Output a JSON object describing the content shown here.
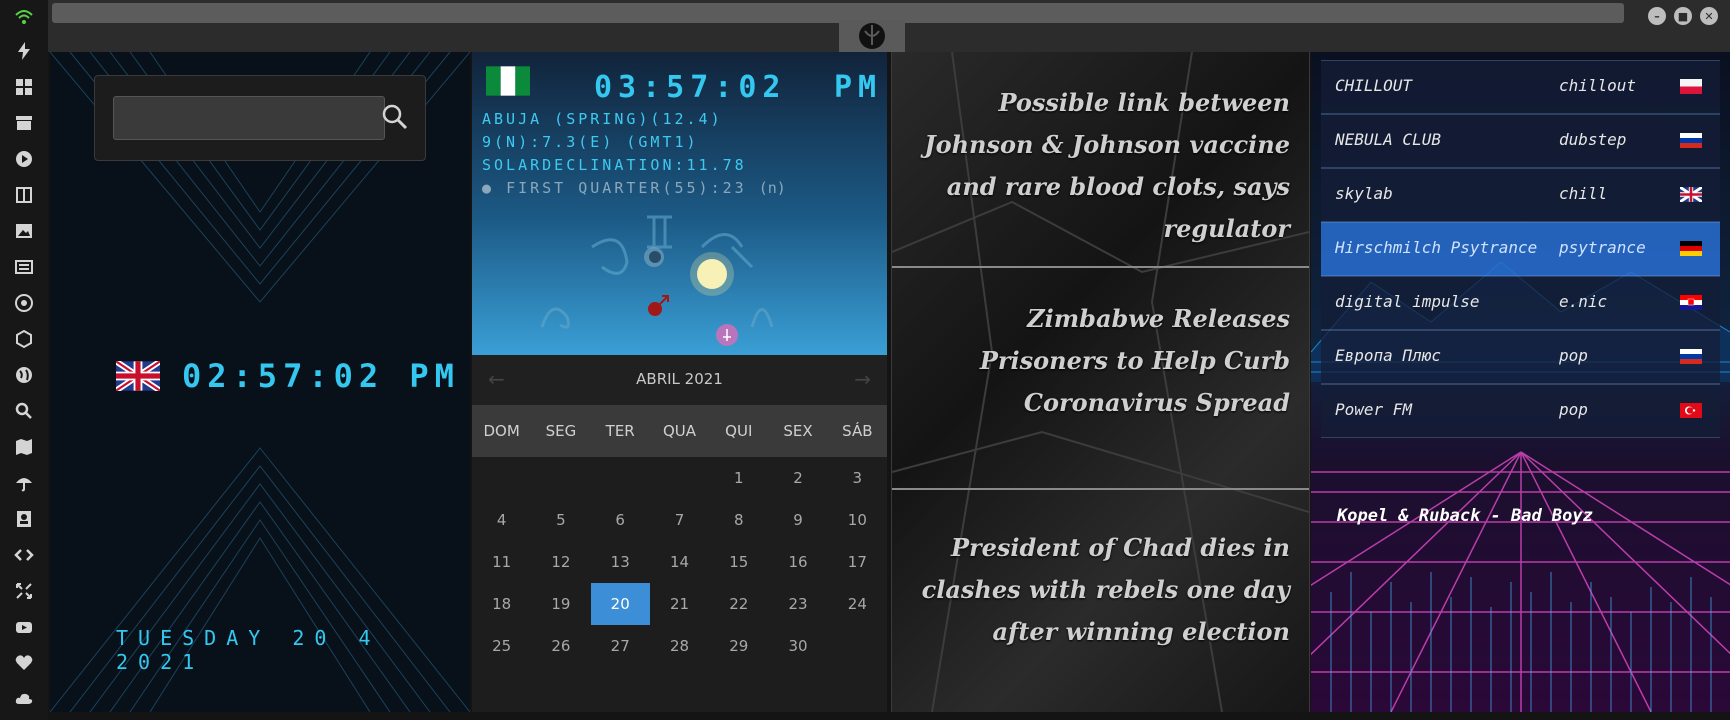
{
  "sidebar": {
    "icons": [
      "wifi-icon",
      "bolt-icon",
      "windows-icon",
      "archive-icon",
      "play-icon",
      "book-icon",
      "image-icon",
      "newspaper-icon",
      "react-icon",
      "hexagon-icon",
      "globe-icon",
      "search-icon",
      "map-icon",
      "umbrella-icon",
      "contact-icon",
      "code-icon",
      "expand-icon",
      "youtube-icon",
      "heart-icon",
      "cloud-icon"
    ]
  },
  "window": {
    "controls": [
      "minimize",
      "maximize",
      "close"
    ]
  },
  "clock_uk": {
    "flag": "uk",
    "time": "02:57:02 PM",
    "date": "TUESDAY 20 4 2021"
  },
  "search": {
    "value": "",
    "placeholder": ""
  },
  "clock_ng": {
    "flag": "nigeria",
    "time": "03:57:02",
    "ampm": "PM",
    "line1": "ABUJA (SPRING)(12.4)",
    "line2": "9(N):7.3(E) (GMT1)",
    "line3": "SOLARDECLINATION:11.78",
    "moon": "FIRST QUARTER(55):23",
    "moon_suffix": "(n)"
  },
  "calendar": {
    "title": "ABRIL 2021",
    "weekdays": [
      "DOM",
      "SEG",
      "TER",
      "QUA",
      "QUI",
      "SEX",
      "SÁB"
    ],
    "rows": [
      [
        "",
        "",
        "",
        "",
        "1",
        "2",
        "3"
      ],
      [
        "4",
        "5",
        "6",
        "7",
        "8",
        "9",
        "10"
      ],
      [
        "11",
        "12",
        "13",
        "14",
        "15",
        "16",
        "17"
      ],
      [
        "18",
        "19",
        "20",
        "21",
        "22",
        "23",
        "24"
      ],
      [
        "25",
        "26",
        "27",
        "28",
        "29",
        "30",
        ""
      ]
    ],
    "today": "20"
  },
  "news": [
    "Possible link between Johnson & Johnson vaccine and rare blood clots, says regulator",
    "Zimbabwe Releases Prisoners to Help Curb Coronavirus Spread",
    "President of Chad dies in clashes with rebels one day after winning election"
  ],
  "radio": {
    "stations": [
      {
        "name": "CHILLOUT",
        "genre": "chillout",
        "flag": "poland"
      },
      {
        "name": "NEBULA CLUB",
        "genre": "dubstep",
        "flag": "russia"
      },
      {
        "name": "skylab",
        "genre": "chill",
        "flag": "uk"
      },
      {
        "name": "Hirschmilch Psytrance",
        "genre": "psytrance",
        "flag": "germany"
      },
      {
        "name": "digital impulse",
        "genre": "e.nic",
        "flag": "croatia"
      },
      {
        "name": "Европа Плюс",
        "genre": "pop",
        "flag": "russia"
      },
      {
        "name": "Power FM",
        "genre": "pop",
        "flag": "turkey"
      }
    ],
    "active_index": 3,
    "now_playing": "Kopel & Ruback - Bad Boyz"
  },
  "colors": {
    "digital": "#34c8f0",
    "today": "#3c8ed6",
    "active_station": "#2a78d8"
  }
}
